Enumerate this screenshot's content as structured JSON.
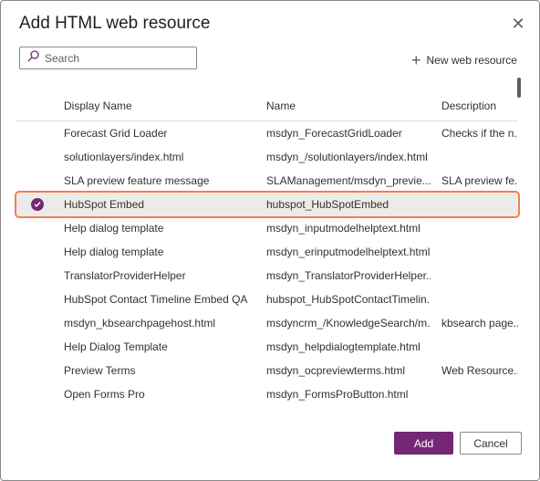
{
  "dialog": {
    "title": "Add HTML web resource",
    "close_icon": "close-icon"
  },
  "search": {
    "placeholder": "Search",
    "icon": "search-icon"
  },
  "toolbar": {
    "new_resource_label": "New web resource",
    "new_resource_icon": "plus-icon"
  },
  "table": {
    "columns": [
      "Display Name",
      "Name",
      "Description"
    ],
    "rows": [
      {
        "display": "Forecast Grid Loader",
        "name": "msdyn_ForecastGridLoader",
        "desc": "Checks if the n..."
      },
      {
        "display": "solutionlayers/index.html",
        "name": "msdyn_/solutionlayers/index.html",
        "desc": ""
      },
      {
        "display": "SLA preview feature message",
        "name": "SLAManagement/msdyn_previe...",
        "desc": "SLA preview fe..."
      },
      {
        "display": "HubSpot Embed",
        "name": "hubspot_HubSpotEmbed",
        "desc": ""
      },
      {
        "display": "Help dialog template",
        "name": "msdyn_inputmodelhelptext.html",
        "desc": ""
      },
      {
        "display": "Help dialog template",
        "name": "msdyn_erinputmodelhelptext.html",
        "desc": ""
      },
      {
        "display": "TranslatorProviderHelper",
        "name": "msdyn_TranslatorProviderHelper...",
        "desc": ""
      },
      {
        "display": "HubSpot Contact Timeline Embed QA",
        "name": "hubspot_HubSpotContactTimelin...",
        "desc": ""
      },
      {
        "display": "msdyn_kbsearchpagehost.html",
        "name": "msdyncrm_/KnowledgeSearch/m...",
        "desc": "kbsearch page..."
      },
      {
        "display": "Help Dialog Template",
        "name": "msdyn_helpdialogtemplate.html",
        "desc": ""
      },
      {
        "display": "Preview Terms",
        "name": "msdyn_ocpreviewterms.html",
        "desc": "Web Resource..."
      },
      {
        "display": "Open Forms Pro",
        "name": "msdyn_FormsProButton.html",
        "desc": ""
      }
    ],
    "selected_index": 3,
    "selected_icon": "checkmark-circle-icon"
  },
  "buttons": {
    "add_label": "Add",
    "cancel_label": "Cancel"
  },
  "colors": {
    "accent": "#742774",
    "highlight_outline": "#ef7f4f"
  }
}
